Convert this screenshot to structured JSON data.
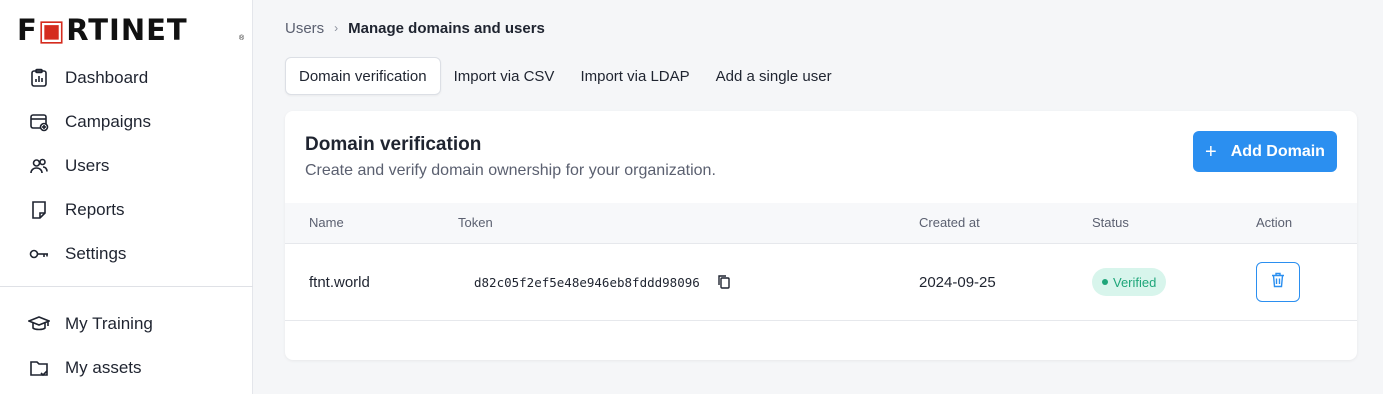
{
  "brand": {
    "name_before_o": "F",
    "name_after_o": "RTINET",
    "reg_mark": "®",
    "accent": "#d52b1e"
  },
  "sidebar": {
    "items": [
      {
        "label": "Dashboard",
        "icon": "dashboard-icon"
      },
      {
        "label": "Campaigns",
        "icon": "campaigns-icon"
      },
      {
        "label": "Users",
        "icon": "users-icon"
      },
      {
        "label": "Reports",
        "icon": "reports-icon"
      },
      {
        "label": "Settings",
        "icon": "key-icon"
      }
    ],
    "secondary_items": [
      {
        "label": "My Training",
        "icon": "graduation-cap-icon"
      },
      {
        "label": "My assets",
        "icon": "folder-icon"
      }
    ]
  },
  "breadcrumb": {
    "parent": "Users",
    "separator": "›",
    "current": "Manage domains and users"
  },
  "tabs": [
    {
      "label": "Domain verification",
      "active": true
    },
    {
      "label": "Import via CSV",
      "active": false
    },
    {
      "label": "Import via LDAP",
      "active": false
    },
    {
      "label": "Add a single user",
      "active": false
    }
  ],
  "card": {
    "title": "Domain verification",
    "subtitle": "Create and verify domain ownership for your organization.",
    "add_button": {
      "icon": "+",
      "label": "Add Domain"
    },
    "primary_color": "#2b8ff0"
  },
  "table": {
    "columns": [
      "Name",
      "Token",
      "Created at",
      "Status",
      "Action"
    ],
    "rows": [
      {
        "name": "ftnt.world",
        "token": "d82c05f2ef5e48e946eb8fddd98096",
        "created_at": "2024-09-25",
        "status": "Verified",
        "status_color": "#1fa67a"
      }
    ]
  }
}
